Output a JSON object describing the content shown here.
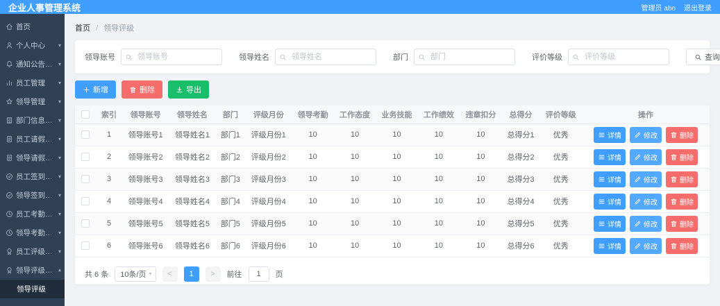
{
  "app": {
    "title": "企业人事管理系统",
    "user": "管理员 abo",
    "logout": "退出登录"
  },
  "breadcrumb": {
    "home": "首页",
    "separator": "/",
    "current": "领导评级"
  },
  "sidebar": [
    {
      "label": "首页",
      "icon": "home",
      "caret": false
    },
    {
      "label": "个人中心",
      "icon": "user",
      "caret": true
    },
    {
      "label": "通知公告管理",
      "icon": "bell",
      "caret": true
    },
    {
      "label": "员工管理",
      "icon": "chart",
      "caret": true
    },
    {
      "label": "领导管理",
      "icon": "star",
      "caret": true
    },
    {
      "label": "部门信息管理",
      "icon": "building",
      "caret": true
    },
    {
      "label": "员工请假管理",
      "icon": "doc",
      "caret": true
    },
    {
      "label": "领导请假管理",
      "icon": "doc",
      "caret": true
    },
    {
      "label": "员工签到管理",
      "icon": "check-circle",
      "caret": true
    },
    {
      "label": "领导签到管理",
      "icon": "check-circle",
      "caret": true
    },
    {
      "label": "员工考勤管理",
      "icon": "clock",
      "caret": true
    },
    {
      "label": "领导考勤管理",
      "icon": "clock",
      "caret": true
    },
    {
      "label": "员工评级管理",
      "icon": "badge",
      "caret": true
    },
    {
      "label": "领导评级管理",
      "icon": "badge",
      "caret": true,
      "expanded": true
    },
    {
      "label": "领导评级",
      "icon": null,
      "sub": true,
      "active": true
    }
  ],
  "filters": {
    "fields": [
      {
        "label": "领导账号",
        "placeholder": "领导账号"
      },
      {
        "label": "领导姓名",
        "placeholder": "领导姓名"
      },
      {
        "label": "部门",
        "placeholder": "部门"
      },
      {
        "label": "评价等级",
        "placeholder": "评价等级"
      }
    ],
    "search_label": "查询"
  },
  "toolbar": {
    "add": "新增",
    "delete": "删除",
    "export": "导出"
  },
  "table": {
    "headers": [
      "索引",
      "领导账号",
      "领导姓名",
      "部门",
      "评级月份",
      "领导考勤",
      "工作态度",
      "业务技能",
      "工作绩效",
      "违章扣分",
      "总得分",
      "评价等级",
      "操作"
    ],
    "rows": [
      [
        "1",
        "领导账号1",
        "领导姓名1",
        "部门1",
        "评级月份1",
        "10",
        "10",
        "10",
        "10",
        "10",
        "总得分1",
        "优秀"
      ],
      [
        "2",
        "领导账号2",
        "领导姓名2",
        "部门2",
        "评级月份2",
        "10",
        "10",
        "10",
        "10",
        "10",
        "总得分2",
        "优秀"
      ],
      [
        "3",
        "领导账号3",
        "领导姓名3",
        "部门3",
        "评级月份3",
        "10",
        "10",
        "10",
        "10",
        "10",
        "总得分3",
        "优秀"
      ],
      [
        "4",
        "领导账号4",
        "领导姓名4",
        "部门4",
        "评级月份4",
        "10",
        "10",
        "10",
        "10",
        "10",
        "总得分4",
        "优秀"
      ],
      [
        "5",
        "领导账号5",
        "领导姓名5",
        "部门5",
        "评级月份5",
        "10",
        "10",
        "10",
        "10",
        "10",
        "总得分5",
        "优秀"
      ],
      [
        "6",
        "领导账号6",
        "领导姓名6",
        "部门6",
        "评级月份6",
        "10",
        "10",
        "10",
        "10",
        "10",
        "总得分6",
        "优秀"
      ]
    ],
    "row_actions": {
      "detail": "详情",
      "edit": "修改",
      "delete": "删除"
    }
  },
  "pagination": {
    "total": "共 6 条",
    "page_size": "10条/页",
    "prev": "<",
    "page": "1",
    "next": ">",
    "goto_prefix": "前往",
    "goto_value": "1",
    "goto_suffix": "页"
  },
  "glyphs": {
    "caret_down": "▾"
  },
  "colors": {
    "header_bg": "#409eff",
    "sidebar_bg": "#304156",
    "primary": "#409eff",
    "info": "#53a8ff",
    "danger": "#f56c6c",
    "success": "#19be6b"
  }
}
